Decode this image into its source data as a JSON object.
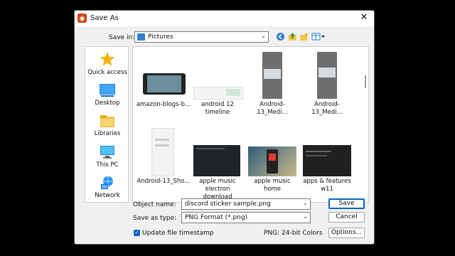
{
  "dialog": {
    "title": "Save As"
  },
  "save_in": {
    "label": "Save in:",
    "value": "Pictures"
  },
  "places": [
    {
      "label": "Quick access",
      "icon": "star-icon"
    },
    {
      "label": "Desktop",
      "icon": "desktop-icon"
    },
    {
      "label": "Libraries",
      "icon": "libraries-icon"
    },
    {
      "label": "This PC",
      "icon": "computer-icon"
    },
    {
      "label": "Network",
      "icon": "network-icon"
    }
  ],
  "files": [
    {
      "name": "amazon-blogs-b..."
    },
    {
      "name": "android 12 timeline"
    },
    {
      "name": "Android-13_Medi..."
    },
    {
      "name": "Android-13_Medi..."
    },
    {
      "name": "Android-13_Sho..."
    },
    {
      "name": "apple music electron download"
    },
    {
      "name": "apple music home"
    },
    {
      "name": "apps & features w11"
    }
  ],
  "object_name": {
    "label": "Object name:",
    "value": "discord sticker sample.png"
  },
  "save_as_type": {
    "label": "Save as type:",
    "value": "PNG Format (*.png)"
  },
  "timestamp": {
    "label": "Update file timestamp",
    "checked": true
  },
  "png_info": "PNG: 24-bit Colors",
  "buttons": {
    "save": "Save",
    "cancel": "Cancel",
    "options": "Options..."
  },
  "colors": {
    "accent": "#0067c0",
    "star": "#f5b400",
    "folder": "#f2c54a",
    "monitor": "#1e88e5"
  }
}
